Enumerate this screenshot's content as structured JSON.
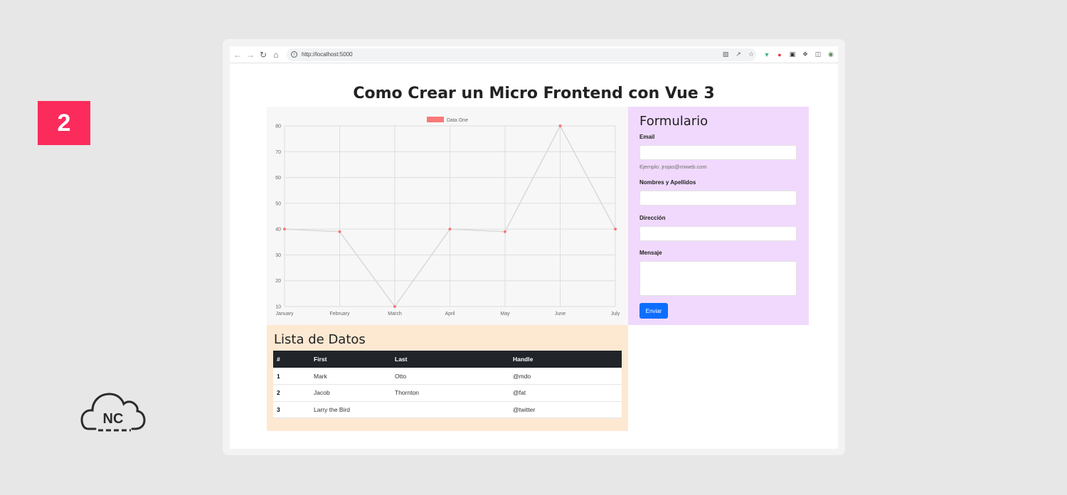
{
  "slide": {
    "step_number": "2",
    "logo_text": "NC"
  },
  "browser": {
    "url": "http://localhost:5000"
  },
  "page": {
    "title": "Como Crear un Micro Frontend con Vue 3"
  },
  "chart_data": {
    "type": "line",
    "categories": [
      "January",
      "February",
      "March",
      "April",
      "May",
      "June",
      "July"
    ],
    "series": [
      {
        "name": "Data One",
        "values": [
          40,
          39,
          10,
          40,
          39,
          80,
          40
        ],
        "color": "#f87979"
      }
    ],
    "ylim": [
      10,
      80
    ],
    "yticks": [
      10,
      20,
      30,
      40,
      50,
      60,
      70,
      80
    ],
    "grid": true,
    "legend": "top"
  },
  "form": {
    "title": "Formulario",
    "email_label": "Email",
    "email_hint": "Ejemplo: jrojas@miweb.com",
    "name_label": "Nombres y Apellidos",
    "address_label": "Dirección",
    "message_label": "Mensaje",
    "submit_label": "Enviar"
  },
  "list": {
    "title": "Lista de Datos",
    "headers": [
      "#",
      "First",
      "Last",
      "Handle"
    ],
    "rows": [
      [
        "1",
        "Mark",
        "Otto",
        "@mdo"
      ],
      [
        "2",
        "Jacob",
        "Thornton",
        "@fat"
      ],
      [
        "3",
        "Larry the Bird",
        "",
        "@twitter"
      ]
    ]
  },
  "colors": {
    "badge": "#fb2c5c",
    "form_bg": "#f0d9fd",
    "list_bg": "#fde8d2",
    "button": "#0d6efd",
    "table_header": "#212529"
  }
}
